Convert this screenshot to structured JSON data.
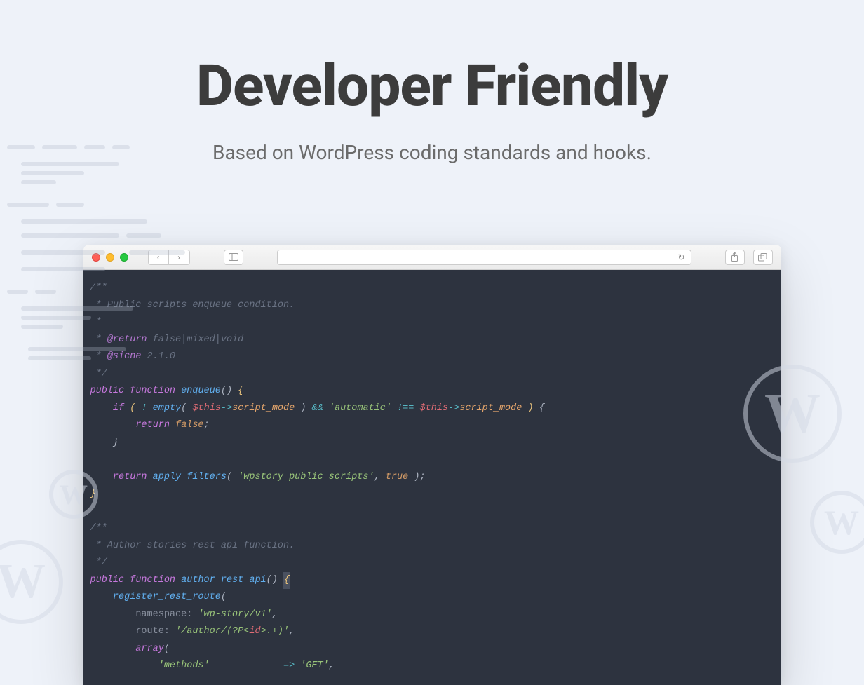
{
  "hero": {
    "title": "Developer Friendly",
    "subtitle": "Based on WordPress coding standards and hooks."
  },
  "code": {
    "comment1_open": "/**",
    "comment1_l1": " * Public scripts enqueue condition.",
    "comment1_l2": " *",
    "comment1_return_label": "@return",
    "comment1_return_text": " false|mixed|void",
    "comment1_since_label": "@sicne",
    "comment1_since_text": " 2.1.0",
    "comment_close": " */",
    "kw_public": "public",
    "kw_function": "function",
    "fn_enqueue": "enqueue",
    "kw_if": "if",
    "fn_empty": "empty",
    "var_this": "$this",
    "prop_script_mode": "script_mode",
    "str_automatic": "'automatic'",
    "kw_return": "return",
    "bool_false": "false",
    "bool_true": "true",
    "fn_apply_filters": "apply_filters",
    "str_wpstory": "'wpstory_public_scripts'",
    "comment2_l1": " * Author stories rest api function.",
    "fn_author_rest": "author_rest_api",
    "fn_register_route": "register_rest_route",
    "lbl_namespace": "namespace:",
    "str_wp_story_v1": "'wp-story/v1'",
    "lbl_route": "route:",
    "str_route_1": "'/author/(?P<",
    "str_route_id": "id",
    "str_route_2": ">.+)'",
    "kw_array": "array",
    "str_methods": "'methods'",
    "str_get": "'GET'"
  }
}
